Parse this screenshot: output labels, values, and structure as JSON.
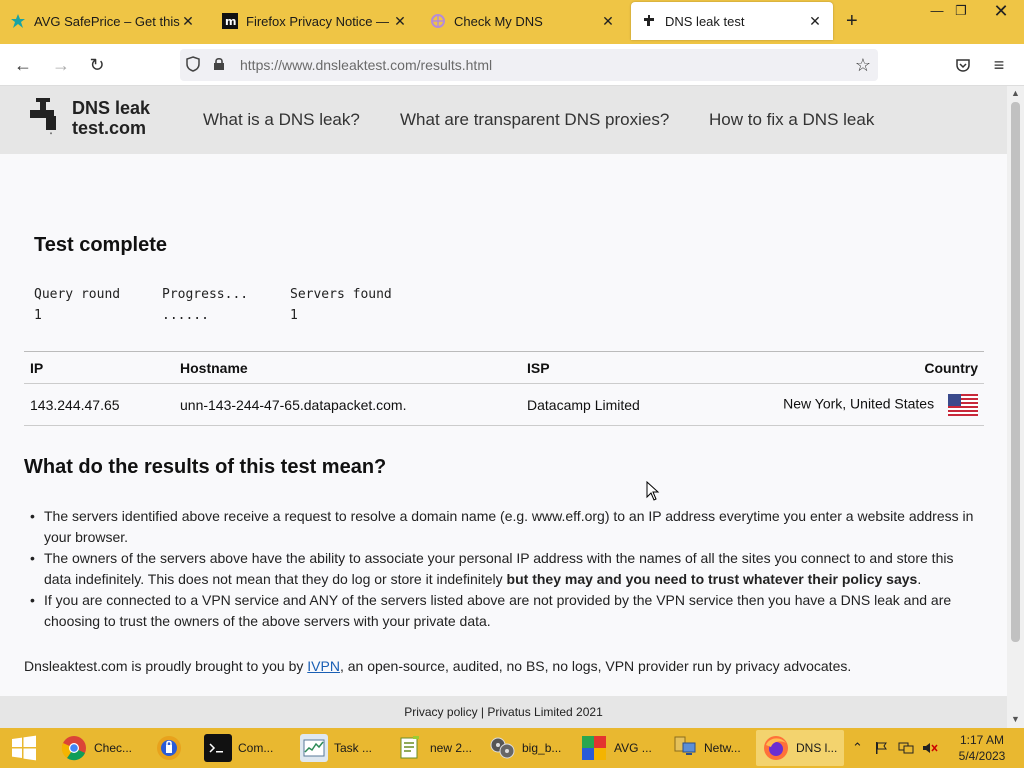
{
  "browser": {
    "tabs": [
      {
        "title": "AVG SafePrice – Get this Exte",
        "icon": "avg-icon"
      },
      {
        "title": "Firefox Privacy Notice — Mo",
        "icon": "mozilla-icon"
      },
      {
        "title": "Check My DNS",
        "icon": "checkmydns-icon"
      },
      {
        "title": "DNS leak test",
        "icon": "dnsleak-tap-icon"
      }
    ],
    "url": "https://www.dnsleaktest.com/results.html"
  },
  "site": {
    "logo_line1": "DNS leak",
    "logo_line2": "test.com",
    "menu": [
      "What is a DNS leak?",
      "What are transparent DNS proxies?",
      "How to fix a DNS leak"
    ]
  },
  "test": {
    "status": "Test complete",
    "query_round_label": "Query round",
    "progress_label": "Progress...",
    "servers_found_label": "Servers found",
    "query_round_value": "1",
    "progress_value": "......",
    "servers_found_value": "1"
  },
  "results": {
    "headers": [
      "IP",
      "Hostname",
      "ISP",
      "Country"
    ],
    "rows": [
      {
        "ip": "143.244.47.65",
        "hostname": "unn-143-244-47-65.datapacket.com.",
        "isp": "Datacamp Limited",
        "country": "New York, United States"
      }
    ]
  },
  "explain": {
    "heading": "What do the results of this test mean?",
    "bullet1": "The servers identified above receive a request to resolve a domain name (e.g. www.eff.org) to an IP address everytime you enter a website address in your browser.",
    "bullet2_plain": "The owners of the servers above have the ability to associate your personal IP address with the names of all the sites you connect to and store this data indefinitely. This does not mean that they do log or store it indefinitely ",
    "bullet2_bold": "but they may and you need to trust whatever their policy says",
    "bullet2_end": ".",
    "bullet3": "If you are connected to a VPN service and ANY of the servers listed above are not provided by the VPN service then you have a DNS leak and are choosing to trust the owners of the above servers with your private data.",
    "brought_prefix": "Dnsleaktest.com is proudly brought to you by ",
    "brought_link": "IVPN",
    "brought_suffix": ", an open-source, audited, no BS, no logs, VPN provider run by privacy advocates."
  },
  "footer": {
    "text": "Privacy policy | Privatus Limited 2021"
  },
  "taskbar": {
    "items": [
      {
        "label": "Chec...",
        "icon": "chrome-icon"
      },
      {
        "label": "",
        "icon": "avg-secure-browser-icon"
      },
      {
        "label": "Com...",
        "icon": "cmd-icon"
      },
      {
        "label": "Task ...",
        "icon": "task-manager-icon"
      },
      {
        "label": "new 2...",
        "icon": "notepadpp-icon"
      },
      {
        "label": "big_b...",
        "icon": "media-icon"
      },
      {
        "label": "AVG ...",
        "icon": "avg-app-icon"
      },
      {
        "label": "Netw...",
        "icon": "network-icon"
      },
      {
        "label": "DNS l...",
        "icon": "firefox-icon"
      }
    ],
    "time": "1:17 AM",
    "date": "5/4/2023"
  },
  "colors": {
    "tabbar": "#efc545",
    "taskbar": "#e9b830",
    "link": "#1a5fb4"
  }
}
